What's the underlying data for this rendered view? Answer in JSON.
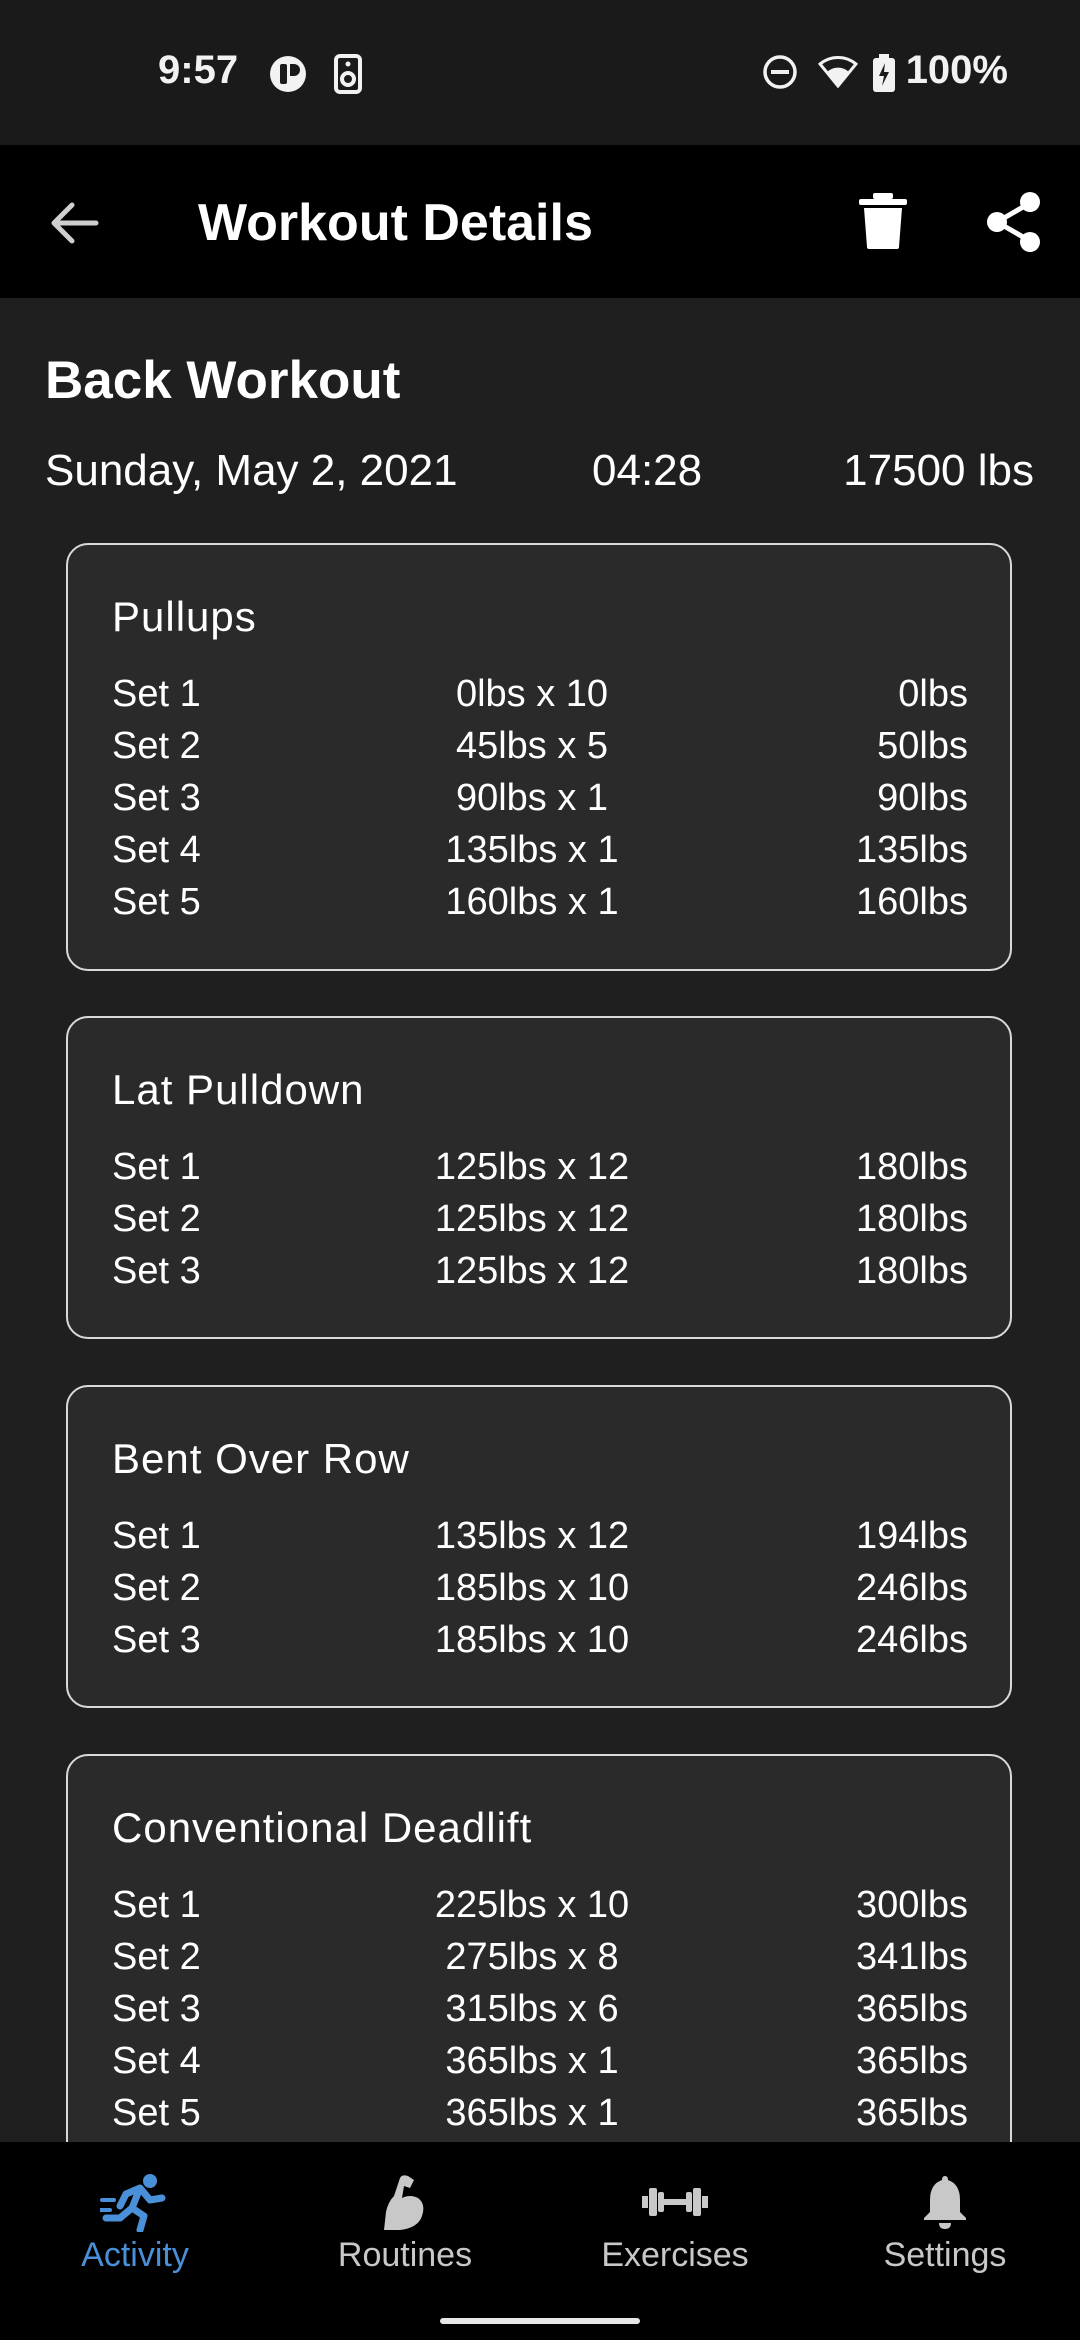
{
  "status_bar": {
    "time": "9:57",
    "battery_text": "100%"
  },
  "app_bar": {
    "title": "Workout Details"
  },
  "workout": {
    "name": "Back Workout",
    "date": "Sunday, May 2, 2021",
    "duration": "04:28",
    "total_weight": "17500 lbs"
  },
  "exercises": [
    {
      "name": "Pullups",
      "sets": [
        {
          "label": "Set 1",
          "detail": "0lbs x 10",
          "est": "0lbs"
        },
        {
          "label": "Set 2",
          "detail": "45lbs x 5",
          "est": "50lbs"
        },
        {
          "label": "Set 3",
          "detail": "90lbs x 1",
          "est": "90lbs"
        },
        {
          "label": "Set 4",
          "detail": "135lbs x 1",
          "est": "135lbs"
        },
        {
          "label": "Set 5",
          "detail": "160lbs x 1",
          "est": "160lbs"
        }
      ]
    },
    {
      "name": "Lat Pulldown",
      "sets": [
        {
          "label": "Set 1",
          "detail": "125lbs x 12",
          "est": "180lbs"
        },
        {
          "label": "Set 2",
          "detail": "125lbs x 12",
          "est": "180lbs"
        },
        {
          "label": "Set 3",
          "detail": "125lbs x 12",
          "est": "180lbs"
        }
      ]
    },
    {
      "name": "Bent Over Row",
      "sets": [
        {
          "label": "Set 1",
          "detail": "135lbs x 12",
          "est": "194lbs"
        },
        {
          "label": "Set 2",
          "detail": "185lbs x 10",
          "est": "246lbs"
        },
        {
          "label": "Set 3",
          "detail": "185lbs x 10",
          "est": "246lbs"
        }
      ]
    },
    {
      "name": "Conventional Deadlift",
      "sets": [
        {
          "label": "Set 1",
          "detail": "225lbs x 10",
          "est": "300lbs"
        },
        {
          "label": "Set 2",
          "detail": "275lbs x 8",
          "est": "341lbs"
        },
        {
          "label": "Set 3",
          "detail": "315lbs x 6",
          "est": "365lbs"
        },
        {
          "label": "Set 4",
          "detail": "365lbs x 1",
          "est": "365lbs"
        },
        {
          "label": "Set 5",
          "detail": "365lbs x 1",
          "est": "365lbs"
        }
      ]
    }
  ],
  "bottom_nav": {
    "items": [
      {
        "label": "Activity",
        "icon": "running-icon",
        "active": true
      },
      {
        "label": "Routines",
        "icon": "flexed-arm-icon",
        "active": false
      },
      {
        "label": "Exercises",
        "icon": "dumbbell-icon",
        "active": false
      },
      {
        "label": "Settings",
        "icon": "bell-icon",
        "active": false
      }
    ]
  },
  "colors": {
    "background": "#1f1f1f",
    "card": "#2a2a2a",
    "accent": "#4a90d9",
    "app_bar": "#000000"
  }
}
